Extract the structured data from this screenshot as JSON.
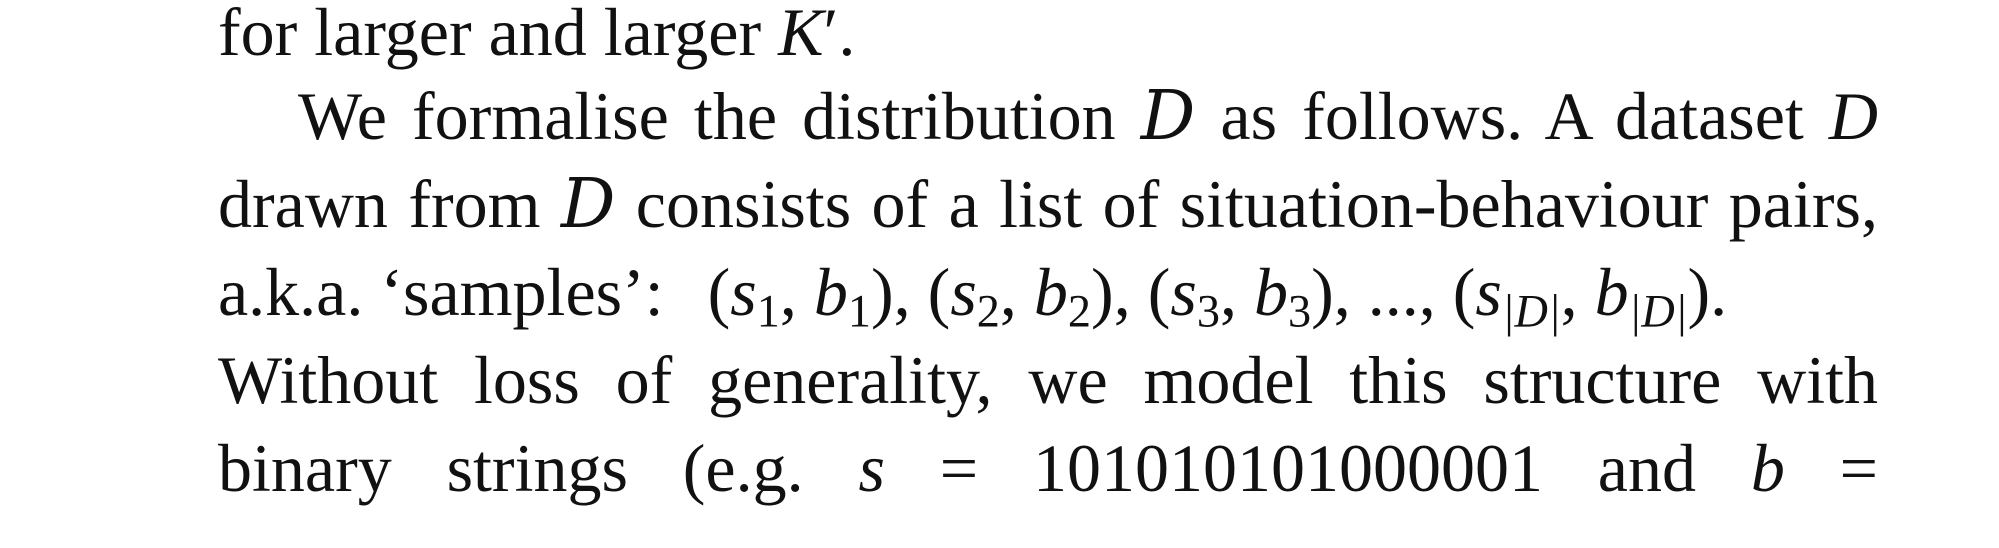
{
  "paragraph": {
    "line1": {
      "text": "for larger and larger ",
      "symbol": "K",
      "prime": "′",
      "end": "."
    },
    "line2": {
      "before": "We formalise the distribution ",
      "dist": "D",
      "middle": " as follows. A dataset ",
      "dataset": "D"
    },
    "line3": {
      "before": "drawn from ",
      "dist": "D",
      "after": " consists of a list of situation-behaviour pairs,"
    },
    "line4": {
      "before": "a.k.a. ‘samples’:",
      "s": "s",
      "b": "b",
      "i1": "1",
      "i2": "2",
      "i3": "3",
      "ellipsis": "...,",
      "last": "|D|"
    },
    "line5": {
      "text": "Without loss of generality, we model this structure with"
    },
    "line6": {
      "w1": "binary",
      "w2": "strings",
      "w3": "(e.g.",
      "s": "s",
      "eq": "=",
      "value": "101010101000001",
      "w4": "and",
      "b": "b",
      "eq2": "="
    }
  }
}
